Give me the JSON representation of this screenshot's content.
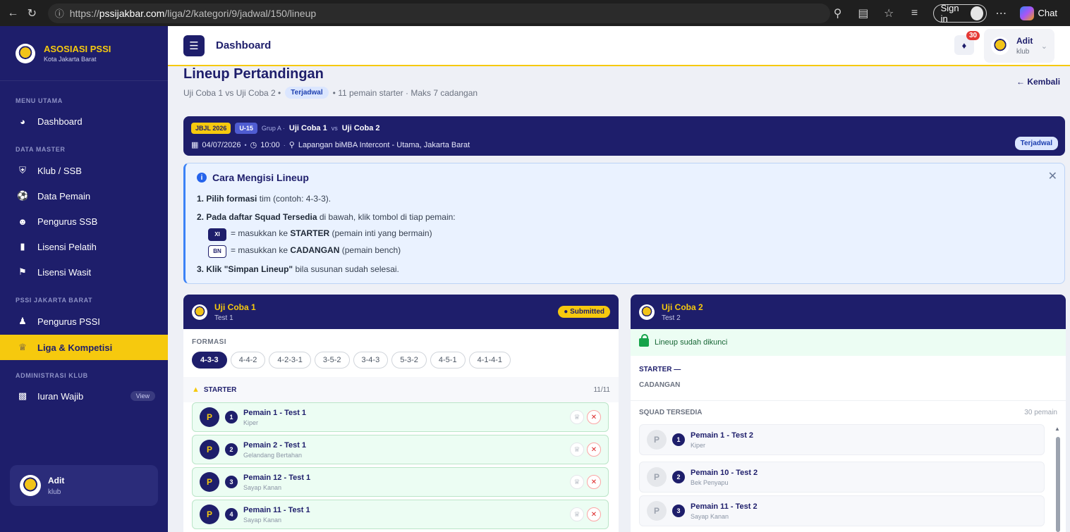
{
  "browser": {
    "url_prefix": "https://",
    "url_host": "pssijakbar.com",
    "url_path": "/liga/2/kategori/9/jadwal/150/lineup",
    "signin_label": "Sign in",
    "copilot_label": "Chat"
  },
  "sidebar": {
    "brand_title": "ASOSIASI PSSI",
    "brand_sub": "Kota Jakarta Barat",
    "sections": {
      "menu_utama": "MENU UTAMA",
      "data_master": "DATA MASTER",
      "pssi": "PSSI JAKARTA BARAT",
      "admin_klub": "ADMINISTRASI KLUB"
    },
    "items": {
      "dashboard": "Dashboard",
      "klub": "Klub / SSB",
      "pemain": "Data Pemain",
      "pengurus_ssb": "Pengurus SSB",
      "lisensi_pelatih": "Lisensi Pelatih",
      "lisensi_wasit": "Lisensi Wasit",
      "pengurus_pssi": "Pengurus PSSI",
      "liga": "Liga & Kompetisi",
      "iuran": "Iuran Wajib",
      "iuran_badge": "View"
    },
    "user": {
      "name": "Adit",
      "role": "klub"
    }
  },
  "header": {
    "title": "Dashboard",
    "notif_count": "30",
    "user_name": "Adit",
    "user_role": "klub"
  },
  "page": {
    "title": "Lineup Pertandingan",
    "sub_teams": "Uji Coba 1 vs Uji Coba 2 •",
    "sub_status": "Terjadwal",
    "sub_rest": "• 11 pemain starter · Maks 7 cadangan",
    "back_label": "Kembali"
  },
  "match": {
    "league": "JBJL 2026",
    "category": "U-15",
    "group": "Grup A ·",
    "home": "Uji Coba 1",
    "vs": "vs",
    "away": "Uji Coba 2",
    "date": "04/07/2026",
    "time": "10:00",
    "venue": "Lapangan biMBA Intercont - Utama, Jakarta Barat",
    "status": "Terjadwal"
  },
  "info": {
    "title": "Cara Mengisi Lineup",
    "step1_pre": "1. Pilih",
    "step1_bold": "formasi",
    "step1_post": "tim (contoh: 4-3-3).",
    "step2_pre": "2. Pada daftar",
    "step2_bold": "Squad Tersedia",
    "step2_post": "di bawah, klik tombol di tiap pemain:",
    "xi_key": "XI",
    "xi_pre": "= masukkan ke",
    "xi_bold": "STARTER",
    "xi_post": "(pemain inti yang bermain)",
    "bn_key": "BN",
    "bn_pre": "= masukkan ke",
    "bn_bold": "CADANGAN",
    "bn_post": "(pemain bench)",
    "step3_pre": "3. Klik",
    "step3_bold": "\"Simpan Lineup\"",
    "step3_post": "bila susunan sudah selesai."
  },
  "team_left": {
    "name": "Uji Coba 1",
    "sub": "Test 1",
    "status": "Submitted",
    "formasi_label": "FORMASI",
    "formations": [
      "4-3-3",
      "4-4-2",
      "4-2-3-1",
      "3-5-2",
      "3-4-3",
      "5-3-2",
      "4-5-1",
      "4-1-4-1"
    ],
    "starter_label": "STARTER",
    "starter_count": "11/11",
    "players": [
      {
        "pos": "P",
        "num": "1",
        "name": "Pemain 1 - Test 1",
        "role": "Kiper"
      },
      {
        "pos": "P",
        "num": "2",
        "name": "Pemain 2 - Test 1",
        "role": "Gelandang Bertahan"
      },
      {
        "pos": "P",
        "num": "3",
        "name": "Pemain 12 - Test 1",
        "role": "Sayap Kanan"
      },
      {
        "pos": "P",
        "num": "4",
        "name": "Pemain 11 - Test 1",
        "role": "Sayap Kanan"
      }
    ]
  },
  "team_right": {
    "name": "Uji Coba 2",
    "sub": "Test 2",
    "locked_label": "Lineup sudah dikunci",
    "starter_label": "STARTER —",
    "cadangan_label": "CADANGAN",
    "squad_label": "SQUAD TERSEDIA",
    "squad_count": "30 pemain",
    "players": [
      {
        "pos": "P",
        "num": "1",
        "name": "Pemain 1 - Test 2",
        "role": "Kiper"
      },
      {
        "pos": "P",
        "num": "2",
        "name": "Pemain 10 - Test 2",
        "role": "Bek Penyapu"
      },
      {
        "pos": "P",
        "num": "3",
        "name": "Pemain 11 - Test 2",
        "role": "Sayap Kanan"
      }
    ]
  }
}
